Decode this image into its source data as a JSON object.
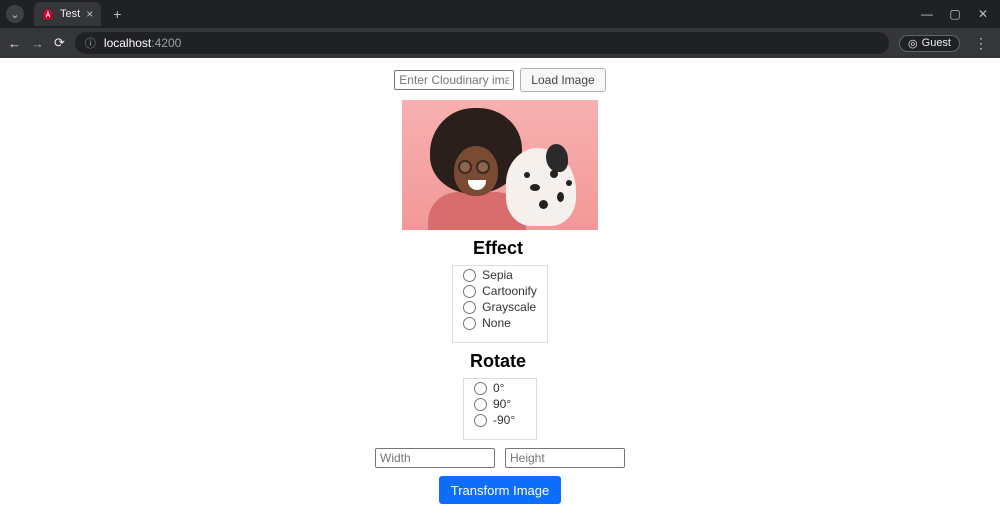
{
  "browser": {
    "tab_title": "Test",
    "url_host": "localhost",
    "url_rest": ":4200",
    "guest_label": "Guest"
  },
  "loader": {
    "id_placeholder": "Enter Cloudinary image ID",
    "load_button": "Load Image"
  },
  "effect": {
    "title": "Effect",
    "options": [
      "Sepia",
      "Cartoonify",
      "Grayscale",
      "None"
    ]
  },
  "rotate": {
    "title": "Rotate",
    "options": [
      "0°",
      "90°",
      "-90°"
    ]
  },
  "dimensions": {
    "width_placeholder": "Width",
    "height_placeholder": "Height"
  },
  "transform_button": "Transform Image"
}
